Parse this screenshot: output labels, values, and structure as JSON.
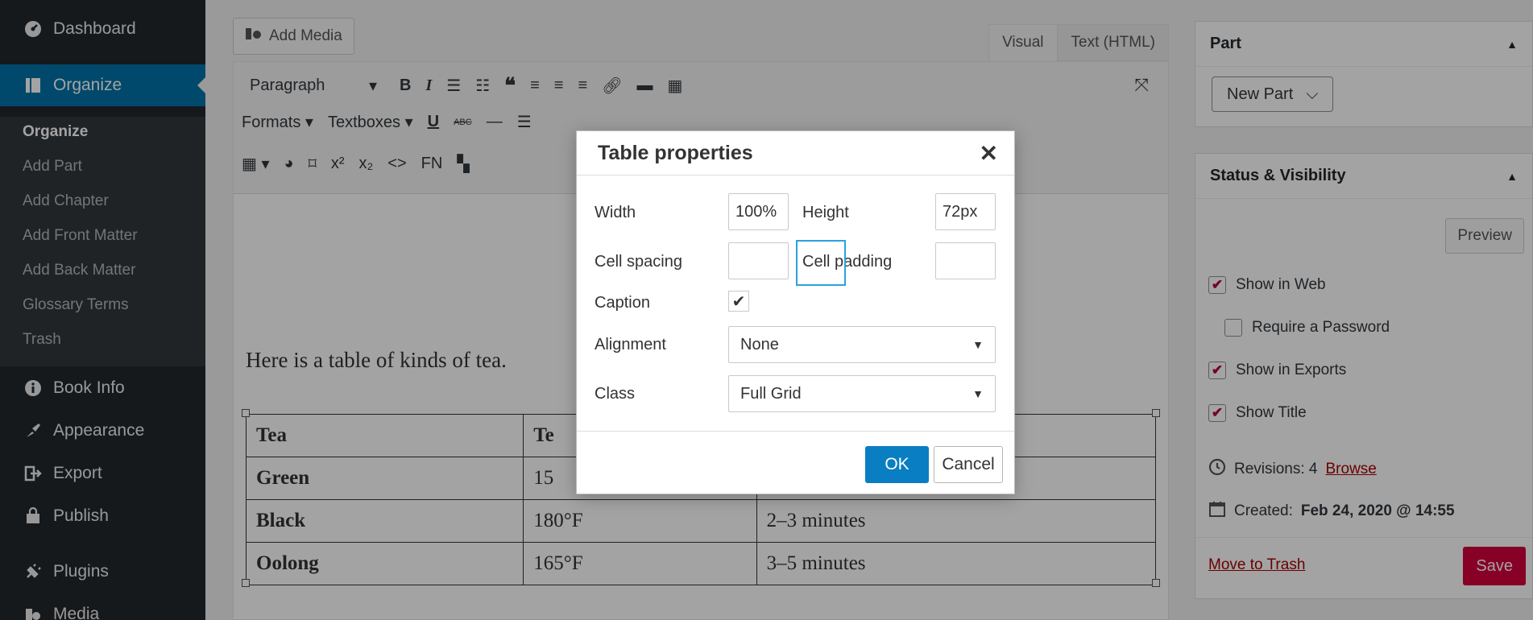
{
  "sidebar": {
    "dashboard": "Dashboard",
    "organize": "Organize",
    "submenu": [
      "Organize",
      "Add Part",
      "Add Chapter",
      "Add Front Matter",
      "Add Back Matter",
      "Glossary Terms",
      "Trash"
    ],
    "book_info": "Book Info",
    "appearance": "Appearance",
    "export": "Export",
    "publish": "Publish",
    "plugins": "Plugins",
    "media": "Media"
  },
  "editor": {
    "add_media": "Add Media",
    "tab_visual": "Visual",
    "tab_text": "Text (HTML)",
    "paragraph_select": "Paragraph",
    "formats": "Formats",
    "textboxes": "Textboxes",
    "fn": "FN",
    "paragraph_text": "Here is a table of kinds of tea.",
    "table": {
      "rows": [
        [
          "Tea",
          "Te",
          ""
        ],
        [
          "Green",
          "15",
          ""
        ],
        [
          "Black",
          "180°F",
          "2–3 minutes"
        ],
        [
          "Oolong",
          "165°F",
          "3–5 minutes"
        ]
      ]
    }
  },
  "panels": {
    "part_title": "Part",
    "part_select": "New Part",
    "status_title": "Status & Visibility",
    "preview": "Preview",
    "show_in_web": "Show in Web",
    "require_password": "Require a Password",
    "show_in_exports": "Show in Exports",
    "show_title": "Show Title",
    "revisions_label": "Revisions: 4",
    "revisions_link": "Browse",
    "created_label": "Created:",
    "created_value": "Feb 24, 2020 @ 14:55",
    "move_to_trash": "Move to Trash",
    "save": "Save"
  },
  "dialog": {
    "title": "Table properties",
    "width_label": "Width",
    "width_value": "100%",
    "height_label": "Height",
    "height_value": "72px",
    "cell_spacing_label": "Cell spacing",
    "cell_spacing_value": "",
    "cell_padding_label": "Cell padding",
    "cell_padding_value": "",
    "caption_label": "Caption",
    "caption_checked": true,
    "alignment_label": "Alignment",
    "alignment_value": "None",
    "class_label": "Class",
    "class_value": "Full Grid",
    "ok": "OK",
    "cancel": "Cancel"
  },
  "colors": {
    "accent_blue": "#0a7ec2",
    "save_red": "#d4003b",
    "link_red": "#aa0000",
    "sidebar_bg": "#23282d"
  }
}
